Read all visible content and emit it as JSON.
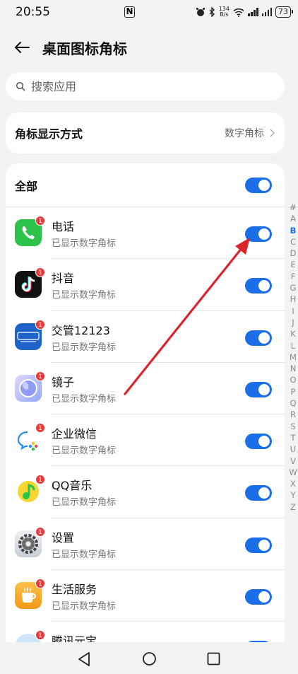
{
  "status": {
    "time": "20:55",
    "nfc": "N",
    "net_speed_value": "134",
    "net_speed_unit": "B/s",
    "battery": "73"
  },
  "header": {
    "title": "桌面图标角标"
  },
  "search": {
    "placeholder": "搜索应用"
  },
  "display_setting": {
    "label": "角标显示方式",
    "value": "数字角标"
  },
  "all": {
    "label": "全部",
    "enabled": true
  },
  "badge_count": "1",
  "apps": [
    {
      "name": "电话",
      "status": "已显示数字角标",
      "enabled": true,
      "icon": "phone-icon",
      "color": "#2dc24a"
    },
    {
      "name": "抖音",
      "status": "已显示数字角标",
      "enabled": true,
      "icon": "douyin-icon",
      "color": "#111111"
    },
    {
      "name": "交管12123",
      "status": "已显示数字角标",
      "enabled": true,
      "icon": "traffic-12123-icon",
      "color": "#1e63c9"
    },
    {
      "name": "镜子",
      "status": "已显示数字角标",
      "enabled": true,
      "icon": "mirror-icon",
      "color": "#7d8ef0"
    },
    {
      "name": "企业微信",
      "status": "已显示数字角标",
      "enabled": true,
      "icon": "wecom-icon",
      "color": "#ffffff"
    },
    {
      "name": "QQ音乐",
      "status": "已显示数字角标",
      "enabled": true,
      "icon": "qq-music-icon",
      "color": "#f7d631"
    },
    {
      "name": "设置",
      "status": "已显示数字角标",
      "enabled": true,
      "icon": "settings-gear-icon",
      "color": "#d9dde3"
    },
    {
      "name": "生活服务",
      "status": "已显示数字角标",
      "enabled": true,
      "icon": "life-service-icon",
      "color": "#f5a623"
    },
    {
      "name": "腾讯元宝",
      "status": "",
      "enabled": true,
      "icon": "yuanbao-icon",
      "color": "#cfe4f7"
    }
  ],
  "index_letters": [
    "#",
    "A",
    "B",
    "C",
    "D",
    "E",
    "F",
    "G",
    "H",
    "I",
    "J",
    "K",
    "L",
    "M",
    "N",
    "O",
    "P",
    "Q",
    "R",
    "S",
    "T",
    "U",
    "V",
    "W",
    "X",
    "Y",
    "Z"
  ],
  "index_active": "B",
  "colors": {
    "accent": "#1a6ee8",
    "badge": "#e83a3a",
    "annotation": "#d9262c"
  }
}
